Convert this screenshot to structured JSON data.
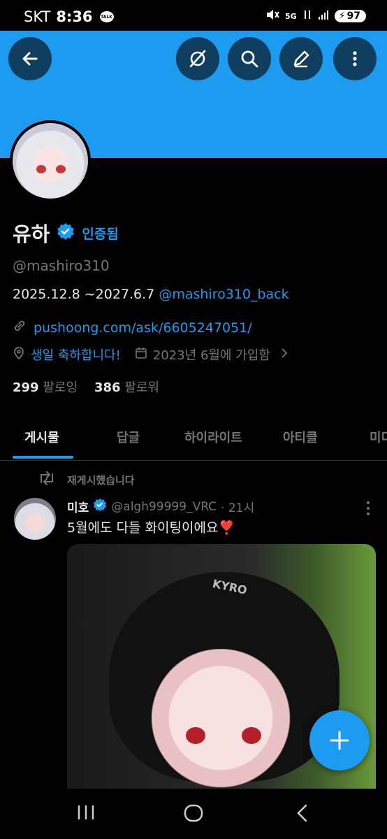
{
  "status_bar": {
    "carrier": "SKT",
    "time": "8:36",
    "talk_badge": "TALK",
    "network": "5G",
    "battery": "97"
  },
  "header": {
    "back_icon": "arrow-left-icon",
    "actions": [
      "grok-icon",
      "search-icon",
      "edit-icon",
      "more-vertical-icon"
    ],
    "banner_color": "#1d9bf0"
  },
  "profile": {
    "name": "유하",
    "verified_label": "인증됨",
    "handle": "@mashiro310",
    "bio_text": "2025.12.8 ~2027.6.7 ",
    "bio_mention": "@mashiro310_back",
    "link": "pushoong.com/ask/6605247051/",
    "birthday": "생일 축하합니다!",
    "joined": "2023년 6월에 가입함",
    "following_count": "299",
    "following_label": "팔로잉",
    "followers_count": "386",
    "followers_label": "팔로워"
  },
  "tabs": [
    "게시물",
    "답글",
    "하이라이트",
    "아티클",
    "미디어"
  ],
  "active_tab": "게시물",
  "post": {
    "repost_label": "재게시했습니다",
    "author_name": "미호",
    "author_handle": "@algh99999_VRC",
    "time": "· 21시",
    "text": "5월에도 다들 화이팅이에요❣️",
    "image_watermark": "KYRO"
  },
  "fab_icon": "plus-icon",
  "nav_bar": [
    "recents-icon",
    "home-icon",
    "back-icon"
  ],
  "accent_color": "#1d9bf0"
}
